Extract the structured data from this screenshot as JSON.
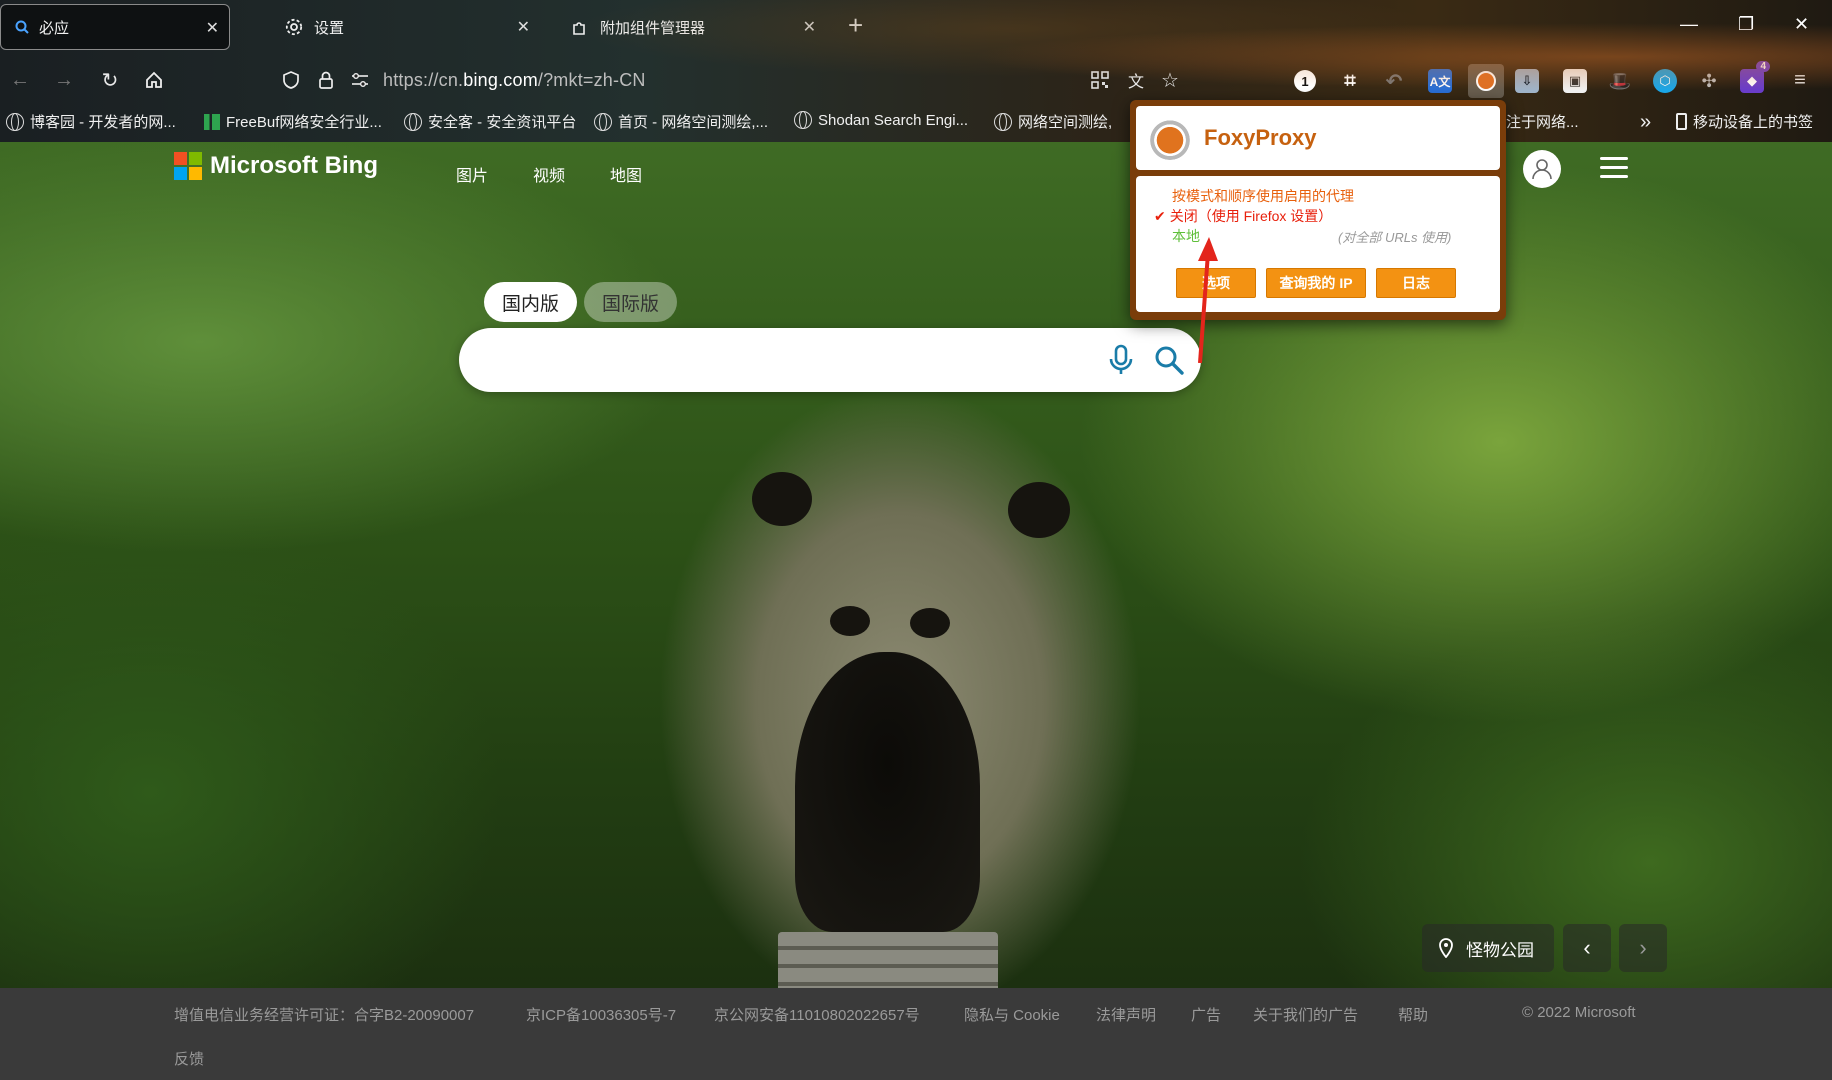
{
  "tabs": [
    {
      "label": "必应",
      "icon": "search-icon",
      "active": true
    },
    {
      "label": "设置",
      "icon": "gear-icon"
    },
    {
      "label": "附加组件管理器",
      "icon": "puzzle-icon"
    }
  ],
  "toolbar": {
    "url_prefix": "https://cn.",
    "url_domain": "bing.com",
    "url_suffix": "/?mkt=zh-CN",
    "badge_number": "1",
    "ext_count": "4"
  },
  "bookmarks": [
    {
      "label": "博客园 - 开发者的网..."
    },
    {
      "label": "FreeBuf网络安全行业..."
    },
    {
      "label": "安全客 - 安全资讯平台"
    },
    {
      "label": "首页 - 网络空间测绘,..."
    },
    {
      "label": "Shodan Search Engi..."
    },
    {
      "label": "网络空间测绘,"
    },
    {
      "label": "注于网络..."
    },
    {
      "label": "移动设备上的书签"
    }
  ],
  "bing": {
    "logo_text": "Microsoft Bing",
    "nav": [
      "图片",
      "视频",
      "地图"
    ],
    "scope_domestic": "国内版",
    "scope_international": "国际版",
    "search_placeholder": "",
    "location": "怪物公园"
  },
  "footer": {
    "links": [
      "增值电信业务经营许可证：合字B2-20090007",
      "京ICP备10036305号-7",
      "京公网安备11010802022657号",
      "隐私与 Cookie",
      "法律声明",
      "广告",
      "关于我们的广告",
      "帮助"
    ],
    "copyright": "© 2022 Microsoft",
    "feedback": "反馈"
  },
  "foxyproxy": {
    "title": "FoxyProxy",
    "mode_patterns": "按模式和顺序使用启用的代理",
    "mode_off": "关闭（使用 Firefox 设置）",
    "check": "✔",
    "local_label": "本地",
    "local_note": "(对全部 URLs 使用)",
    "btn_options": "选项",
    "btn_myip": "查询我的 IP",
    "btn_log": "日志"
  },
  "colors": {
    "accent_orange": "#f39212",
    "fx_title": "#c6610f",
    "fx_red": "#e8200c",
    "fx_green": "#5fbf3a"
  }
}
